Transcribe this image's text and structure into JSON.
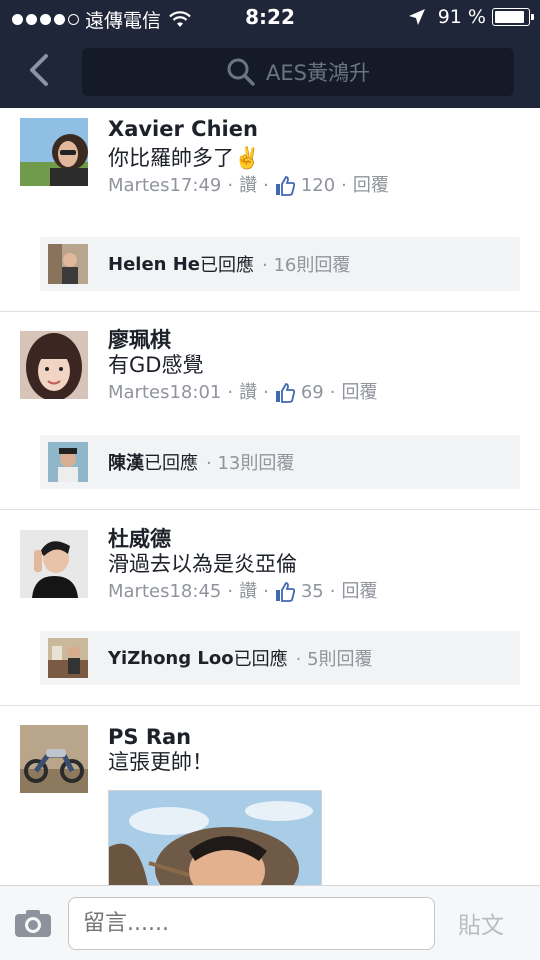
{
  "status_bar": {
    "carrier": "遠傳電信",
    "time": "8:22",
    "battery": "91 %",
    "battery_level": 0.91
  },
  "nav": {
    "search_text": "AES黃鴻升"
  },
  "comments": [
    {
      "name": "Xavier Chien",
      "text": "你比羅帥多了✌️",
      "time": "Martes17:49",
      "like_label": "讚",
      "likes": "120",
      "reply_label": "回覆",
      "reply_preview": {
        "name": "Helen He",
        "action": "已回應",
        "count": "16則回覆"
      }
    },
    {
      "name": "廖珮棋",
      "text": "有GD感覺",
      "time": "Martes18:01",
      "like_label": "讚",
      "likes": "69",
      "reply_label": "回覆",
      "reply_preview": {
        "name": "陳漢",
        "action": "已回應",
        "count": "13則回覆"
      }
    },
    {
      "name": "杜威德",
      "text": "滑過去以為是炎亞倫",
      "time": "Martes18:45",
      "like_label": "讚",
      "likes": "35",
      "reply_label": "回覆",
      "reply_preview": {
        "name": "YiZhong Loo",
        "action": "已回應",
        "count": "5則回覆"
      }
    },
    {
      "name": "PS Ran",
      "text": "這張更帥！"
    }
  ],
  "composer": {
    "placeholder": "留言......",
    "post_label": "貼文"
  },
  "colors": {
    "header_bg": "#20263a",
    "search_bg": "#151a29",
    "like_blue": "#4267b2",
    "meta_gray": "#90949c"
  }
}
